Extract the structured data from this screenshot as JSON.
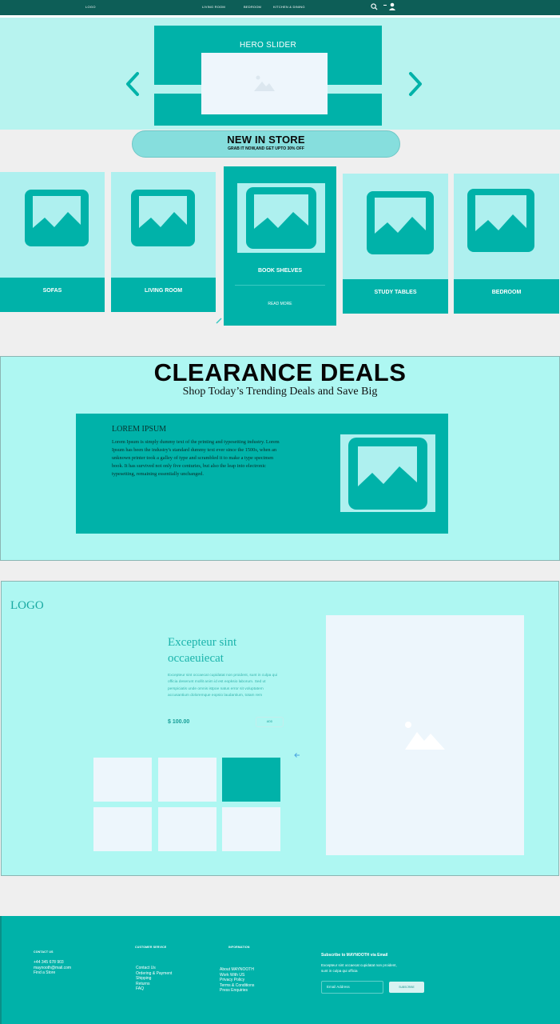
{
  "nav": {
    "logo": "LOGO",
    "links": [
      "LIVING ROOM",
      "BEDROOM",
      "KITCHEN & DINING"
    ],
    "icons": [
      "search-icon",
      "user-icon"
    ]
  },
  "hero": {
    "title": "HERO SLIDER",
    "prev_icon": "chevron-left-icon",
    "next_icon": "chevron-right-icon"
  },
  "promo": {
    "title": "NEW IN STORE",
    "subtitle": "GRAB IT NOW,AND GET UPTO 30% OFF"
  },
  "categories": [
    {
      "label": "SOFAS"
    },
    {
      "label": "LIVING ROOM"
    },
    {
      "label": "BOOK SHELVES",
      "action": "READ MORE"
    },
    {
      "label": "STUDY TABLES"
    },
    {
      "label": "BEDROOM"
    }
  ],
  "clearance": {
    "title": "CLEARANCE DEALS",
    "subtitle": "Shop Today’s Trending Deals and Save Big",
    "card_title": "LOREM IPSUM",
    "card_text": "Lorem Ipsum is simply dummy text of the printing and typesetting industry. Lorem Ipsum has been the industry's standard dummy text ever since the 1500s, when an unknown printer took a galley of type and scrambled it to make a type specimen book. It has survived not only five centuries, but also the leap into electronic typesetting, remaining essentially unchanged."
  },
  "product": {
    "logo": "LOGO",
    "title": "Excepteur sint occaeuiecat",
    "description": "Excepteur sint occaecat cupidatat non proident, sunt in culpa qui officia deserunt mollit anim id est eopksio laborum. Sed ut perspiciatis unde omnis istpoe natus error sit voluptatem accusantium doloremque eopsio laudantium, totam rem",
    "price": "$ 100.00",
    "add_label": "ADD",
    "thumbnails": 6,
    "selected_thumbnail": 3
  },
  "footer": {
    "contact": {
      "heading": "CONTACT US",
      "lines": [
        "+44 345 678 903",
        "maynooth@mail.com",
        "Find a Store"
      ]
    },
    "service": {
      "heading": "CUSTOMER SERVICE",
      "lines": [
        "Contact Us",
        "Ordering & Payment",
        "Shipping",
        "Returns",
        "FAQ"
      ]
    },
    "info": {
      "heading": "INFORMATION",
      "lines": [
        "About MAYNOOTH",
        "Work With US",
        "Privacy Policy",
        "Terms & Conditions",
        "Press Enquiries"
      ]
    },
    "subscribe": {
      "title": "Subscribe to MAYNOOTH via Email",
      "text": "Excepteur sint occaecat cupidatat non proident, sunt in culpa qui officia",
      "placeholder": "Email Address",
      "button": "SUBSCRIBE"
    }
  },
  "colors": {
    "nav": "#0d5e57",
    "teal": "#00b2a9",
    "light_teal": "#aef0ef",
    "mint": "#aef7f2"
  }
}
